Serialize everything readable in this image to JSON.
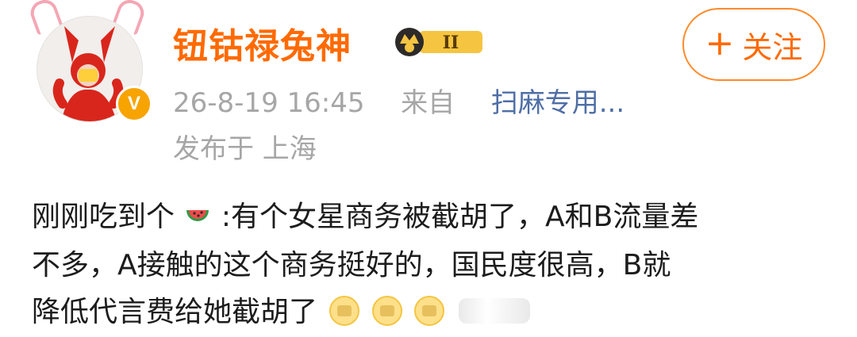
{
  "post": {
    "username": "钮钴禄兔神",
    "level_label": "II",
    "follow_label": "关注",
    "timestamp": "26-8-19 16:45",
    "source_prefix": "来自",
    "source_name": "扫麻专用...",
    "location": "发布于 上海",
    "body_lines": [
      [
        "刚刚吃到个",
        ":有个女星商务被截胡了，A和B流量差"
      ],
      "不多，A接触的这个商务挺好的，国民度很高，B就",
      "降低代言费给她截胡了"
    ]
  },
  "icons": {
    "avatar": "avatar",
    "verified": "verified-badge-icon",
    "level": "crown-level-badge-icon",
    "follow_plus": "plus-icon",
    "watermelon": "watermelon-emoji-icon",
    "emoji_faces": "emoji-face-icon",
    "watermark": "watermark-icon"
  },
  "colors": {
    "brand_orange": "#ff6a00",
    "link_blue": "#4f6ea6",
    "meta_gray": "#a6a6a6",
    "text_dark": "#1c1c1c"
  }
}
